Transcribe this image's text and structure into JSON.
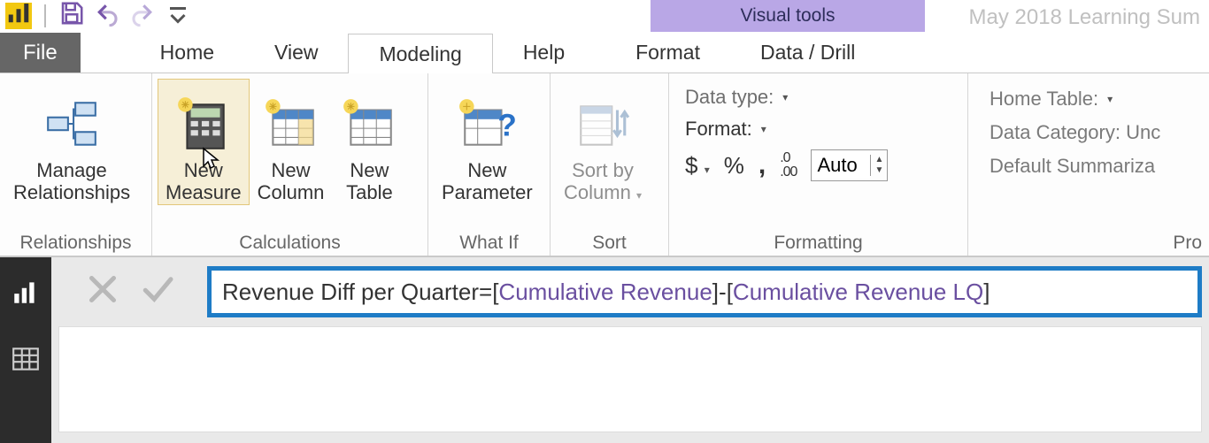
{
  "document_title": "May 2018 Learning Sum",
  "contextual_tab_title": "Visual tools",
  "tabs": {
    "file": "File",
    "home": "Home",
    "view": "View",
    "modeling": "Modeling",
    "help": "Help",
    "format": "Format",
    "data_drill": "Data / Drill"
  },
  "ribbon": {
    "relationships": {
      "group_label": "Relationships",
      "manage": "Manage\nRelationships"
    },
    "calculations": {
      "group_label": "Calculations",
      "new_measure": "New\nMeasure",
      "new_column": "New\nColumn",
      "new_table": "New\nTable"
    },
    "whatif": {
      "group_label": "What If",
      "new_parameter": "New\nParameter"
    },
    "sort": {
      "group_label": "Sort",
      "sort_by_column": "Sort by\nColumn"
    },
    "formatting": {
      "group_label": "Formatting",
      "data_type": "Data type:",
      "format": "Format:",
      "currency": "$",
      "percent": "%",
      "thousands": ",",
      "decimal_icon": ".00",
      "decimal_value": "Auto"
    },
    "properties": {
      "group_label": "Pro",
      "home_table": "Home Table:",
      "data_category": "Data Category: Unc",
      "default_summarization": "Default Summariza"
    }
  },
  "formula": {
    "name": "Revenue Diff per Quarter",
    "equals": " = ",
    "lbr1": "[",
    "m1": "Cumulative Revenue",
    "rbr1": "]",
    "minus": " - ",
    "lbr2": "[",
    "m2": "Cumulative Revenue LQ",
    "rbr2": "]"
  }
}
